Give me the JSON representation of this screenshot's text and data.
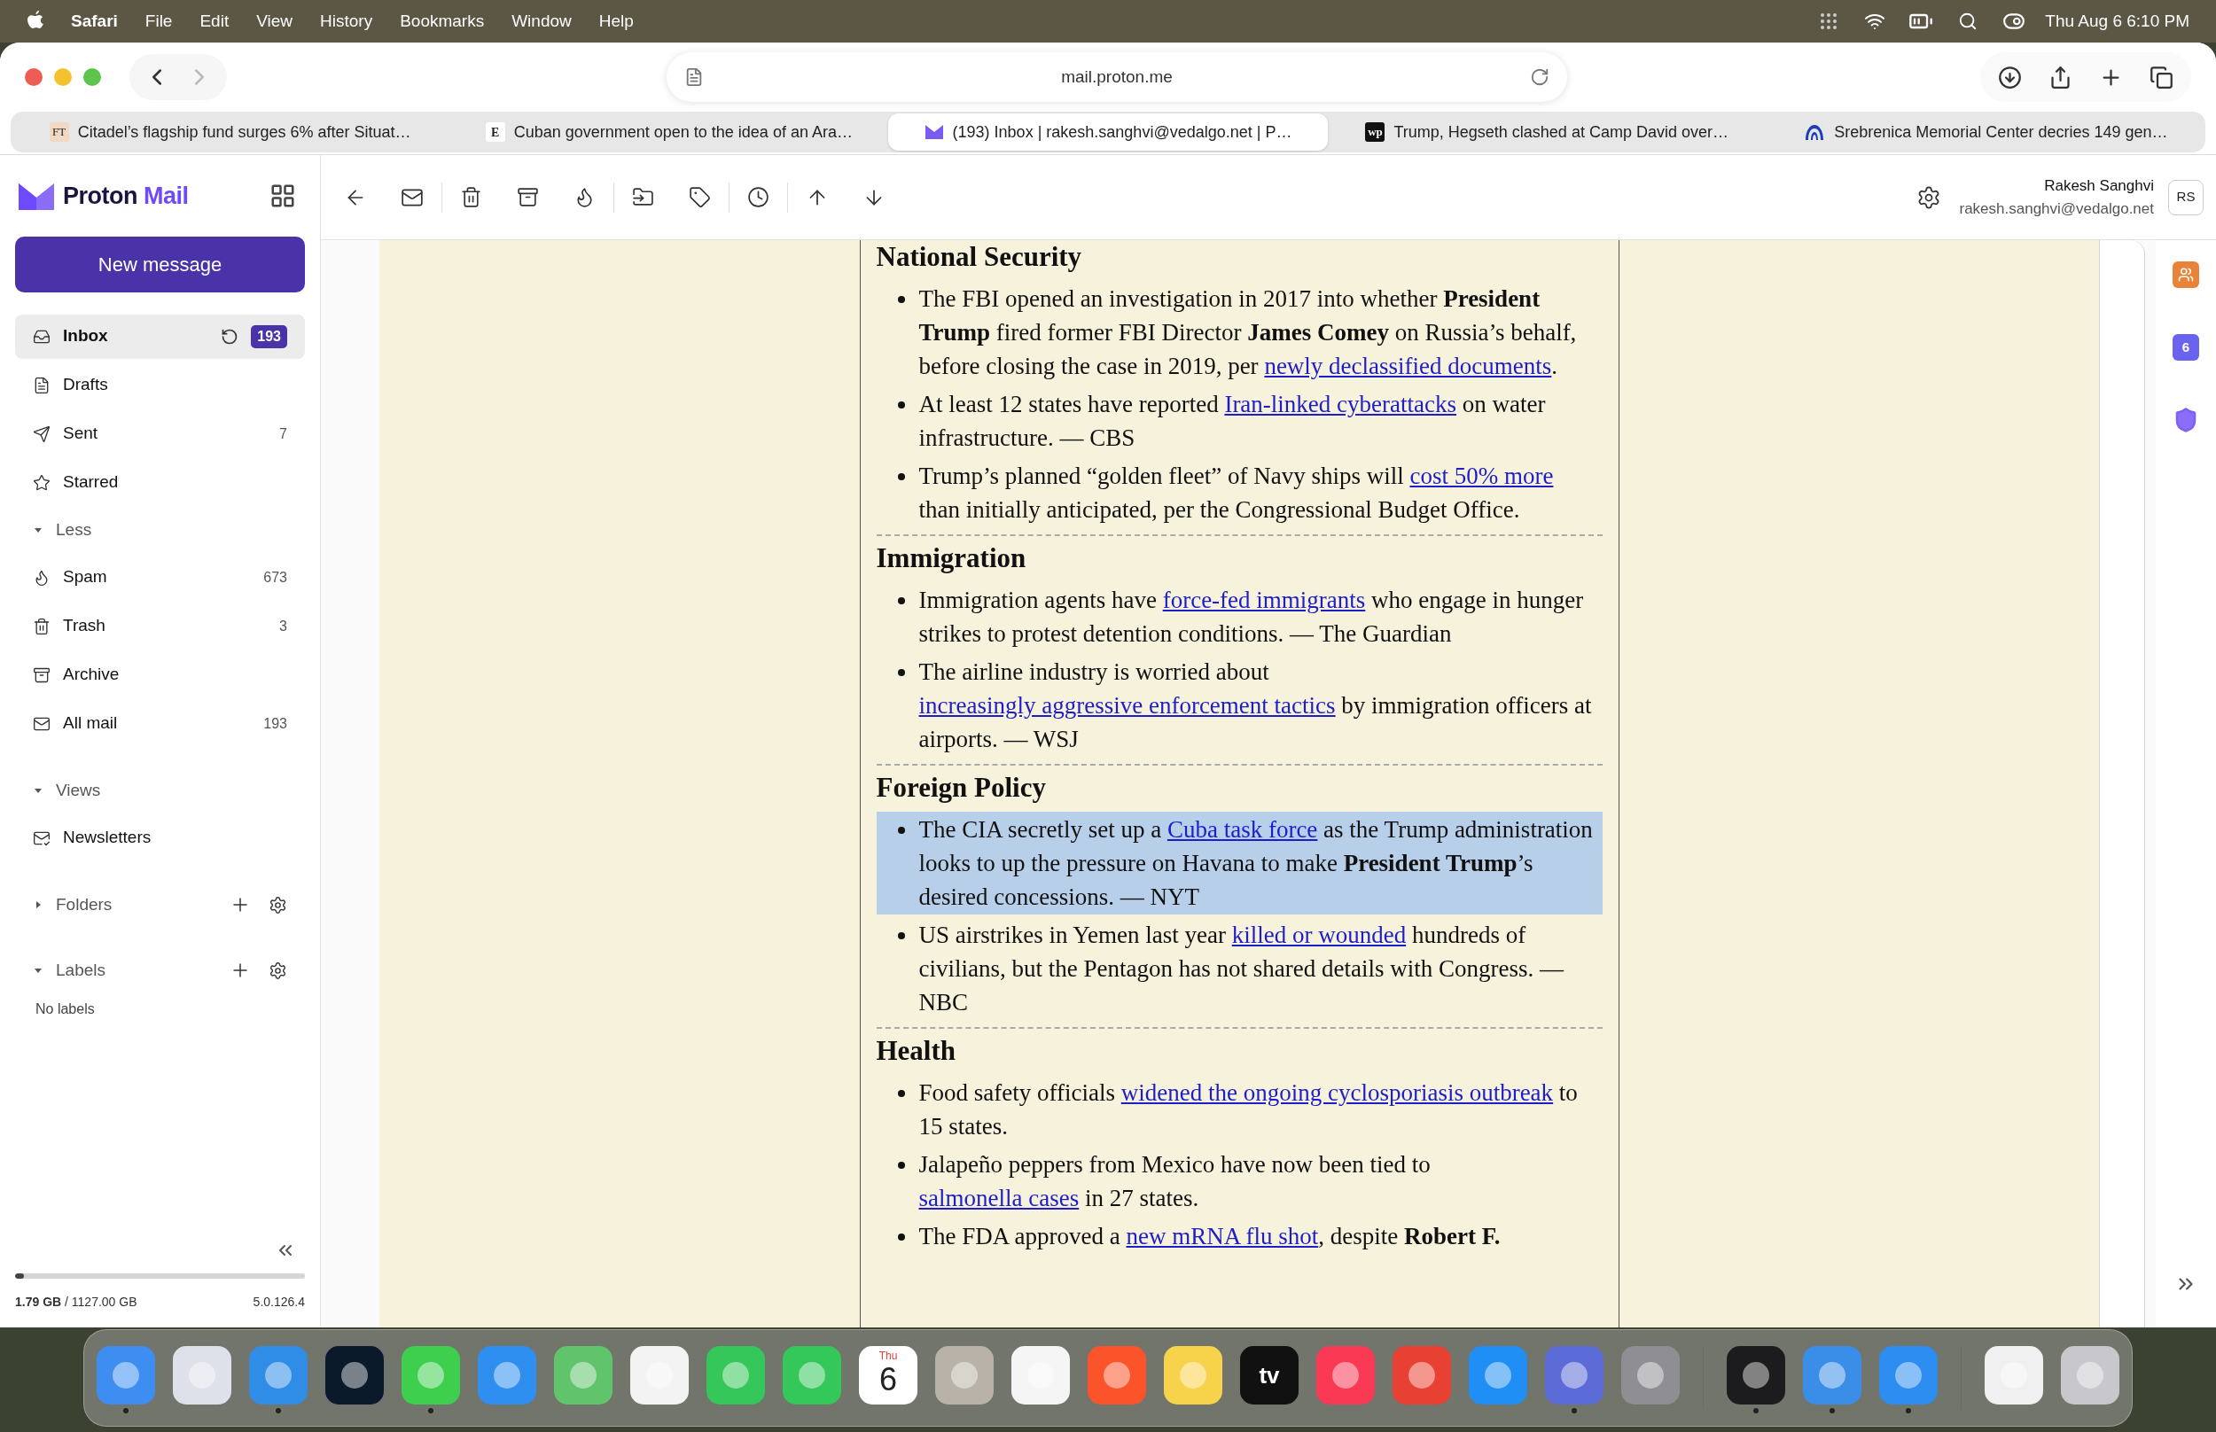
{
  "menu_bar": {
    "app": "Safari",
    "menus": [
      "File",
      "Edit",
      "View",
      "History",
      "Bookmarks",
      "Window",
      "Help"
    ],
    "clock": "Thu Aug 6 6:10 PM"
  },
  "browser": {
    "url": "mail.proton.me",
    "tabs": [
      {
        "title": "Citadel’s flagship fund surges 6% after Situat…",
        "favicon": {
          "kind": "tinted",
          "text": "FT"
        },
        "selected": false
      },
      {
        "title": "Cuban government open to the idea of an Ara…",
        "favicon": {
          "kind": "plain",
          "text": "E"
        },
        "selected": false
      },
      {
        "title": "(193) Inbox | rakesh.sanghvi@vedalgo.net | P…",
        "favicon": {
          "kind": "proton"
        },
        "selected": true
      },
      {
        "title": "Trump, Hegseth clashed at Camp David over…",
        "favicon": {
          "kind": "inverted",
          "text": "wp"
        },
        "selected": false
      },
      {
        "title": "Srebrenica Memorial Center decries 149 gen…",
        "favicon": {
          "kind": "aa"
        },
        "selected": false
      }
    ]
  },
  "mail": {
    "brand": {
      "name": "Proton",
      "product": "Mail"
    },
    "new_message": "New message",
    "sidebar": [
      {
        "kind": "inbox",
        "label": "Inbox",
        "badge": "193",
        "refresh": true,
        "selected": true
      },
      {
        "kind": "drafts",
        "label": "Drafts",
        "selected": false
      },
      {
        "kind": "sent",
        "label": "Sent",
        "count": "7",
        "selected": false
      },
      {
        "kind": "starred",
        "label": "Starred",
        "selected": false
      },
      {
        "kind": "section",
        "label": "Less",
        "expanded": true
      },
      {
        "kind": "spam",
        "label": "Spam",
        "count": "673",
        "selected": false
      },
      {
        "kind": "trash",
        "label": "Trash",
        "count": "3",
        "selected": false
      },
      {
        "kind": "archive",
        "label": "Archive",
        "selected": false
      },
      {
        "kind": "all-mail",
        "label": "All mail",
        "count": "193",
        "selected": false
      },
      {
        "kind": "section",
        "label": "Views",
        "expanded": true
      },
      {
        "kind": "newsletters",
        "label": "Newsletters",
        "selected": false
      },
      {
        "kind": "section",
        "label": "Folders",
        "expanded": false,
        "actions": true
      },
      {
        "kind": "section",
        "label": "Labels",
        "expanded": true,
        "actions": true
      },
      {
        "kind": "note",
        "label": "No labels"
      }
    ],
    "storage": {
      "text": "**1.79 GB** / 1127.00 GB",
      "level": 0.03,
      "version": "5.0.126.4"
    },
    "user": {
      "name": "Rakesh Sanghvi",
      "email": "rakesh.sanghvi@vedalgo.net",
      "initials": "RS"
    },
    "message": {
      "sections": [
        {
          "heading": "National Security",
          "items": [
            {
              "highlighted": false,
              "parts": [
                {
                  "text": "The FBI opened an investigation in 2017 into whether **President Trump** fired former FBI Director **James Comey** on Russia’s behalf, before closing the case in 2019, per "
                },
                {
                  "text": "newly declassified documents",
                  "link": true
                },
                {
                  "text": "."
                }
              ]
            },
            {
              "highlighted": false,
              "parts": [
                {
                  "text": "At least 12 states have reported "
                },
                {
                  "text": "Iran-linked cyberattacks",
                  "link": true
                },
                {
                  "text": " on water infrastructure. — CBS"
                }
              ]
            },
            {
              "highlighted": false,
              "parts": [
                {
                  "text": "Trump’s planned “golden fleet” of Navy ships will "
                },
                {
                  "text": "cost 50% more",
                  "link": true
                },
                {
                  "text": " than initially anticipated, per the Congressional Budget Office."
                }
              ]
            }
          ]
        },
        {
          "heading": "Immigration",
          "items": [
            {
              "highlighted": false,
              "parts": [
                {
                  "text": "Immigration agents have "
                },
                {
                  "text": "force-fed immigrants",
                  "link": true
                },
                {
                  "text": " who engage in hunger strikes to protest detention conditions. — The Guardian"
                }
              ]
            },
            {
              "highlighted": false,
              "parts": [
                {
                  "text": "The airline industry is worried about "
                },
                {
                  "text": "increasingly aggressive enforcement tactics",
                  "link": true
                },
                {
                  "text": " by immigration officers at airports. — WSJ"
                }
              ]
            }
          ]
        },
        {
          "heading": "Foreign Policy",
          "items": [
            {
              "highlighted": true,
              "parts": [
                {
                  "text": "The CIA secretly set up a "
                },
                {
                  "text": "Cuba task force",
                  "link": true
                },
                {
                  "text": " as the Trump administration looks to up the pressure on Havana to make **President Trump**’s desired concessions. — NYT"
                }
              ]
            },
            {
              "highlighted": false,
              "parts": [
                {
                  "text": "US airstrikes in Yemen last year "
                },
                {
                  "text": "killed or wounded",
                  "link": true
                },
                {
                  "text": " hundreds of civilians, but the Pentagon has not shared details with Congress. — NBC"
                }
              ]
            }
          ]
        },
        {
          "heading": "Health",
          "items": [
            {
              "highlighted": false,
              "parts": [
                {
                  "text": "Food safety officials "
                },
                {
                  "text": "widened the ongoing cyclosporiasis outbreak",
                  "link": true
                },
                {
                  "text": " to 15 states."
                }
              ]
            },
            {
              "highlighted": false,
              "parts": [
                {
                  "text": "Jalapeño peppers from Mexico have now been tied to "
                },
                {
                  "text": "salmonella cases",
                  "link": true
                },
                {
                  "text": " in 27 states."
                }
              ]
            },
            {
              "highlighted": false,
              "parts": [
                {
                  "text": "The FDA approved a "
                },
                {
                  "text": "new mRNA flu shot",
                  "link": true
                },
                {
                  "text": ", despite **Robert F.**"
                }
              ]
            }
          ]
        }
      ]
    },
    "right_rail": {
      "calendar_day": "6"
    }
  },
  "dock": [
    {
      "kind": "app",
      "color": "#3d8ef0",
      "running": true
    },
    {
      "kind": "app",
      "color": "#dfe1ea",
      "running": false
    },
    {
      "kind": "app",
      "color": "#2f8de8",
      "running": true
    },
    {
      "kind": "app",
      "color": "#0b1a2a",
      "running": false
    },
    {
      "kind": "app",
      "color": "#3ecf4f",
      "running": true
    },
    {
      "kind": "app",
      "color": "#2f8ff0",
      "running": false
    },
    {
      "kind": "app",
      "color": "#5fc46a",
      "running": false
    },
    {
      "kind": "app",
      "color": "#f3f3f3",
      "running": false
    },
    {
      "kind": "app",
      "color": "#35c759",
      "running": false
    },
    {
      "kind": "app",
      "color": "#34c759",
      "running": false
    },
    {
      "kind": "calendar",
      "top": "Thu",
      "day": "6",
      "running": false
    },
    {
      "kind": "app",
      "color": "#b9b2a8",
      "running": false
    },
    {
      "kind": "app",
      "color": "#f5f5f5",
      "running": false
    },
    {
      "kind": "app",
      "color": "#fb542b",
      "running": false
    },
    {
      "kind": "app",
      "color": "#f7d24b",
      "running": false
    },
    {
      "kind": "labeled",
      "color": "#111111",
      "label": "tv",
      "running": false
    },
    {
      "kind": "app",
      "color": "#fa3a55",
      "running": false
    },
    {
      "kind": "app",
      "color": "#e84032",
      "running": false
    },
    {
      "kind": "app",
      "color": "#1f8ff5",
      "running": false
    },
    {
      "kind": "app",
      "color": "#5b6bd8",
      "running": true
    },
    {
      "kind": "app",
      "color": "#8e8e93",
      "running": false
    },
    {
      "kind": "separator"
    },
    {
      "kind": "app",
      "color": "#1c1c1e",
      "running": true
    },
    {
      "kind": "app",
      "color": "#3b8ee8",
      "running": true
    },
    {
      "kind": "app",
      "color": "#2d8cf0",
      "running": true
    },
    {
      "kind": "separator"
    },
    {
      "kind": "app",
      "color": "#f0f0f0",
      "running": false
    },
    {
      "kind": "app",
      "color": "#c8c8cc",
      "running": false
    }
  ]
}
